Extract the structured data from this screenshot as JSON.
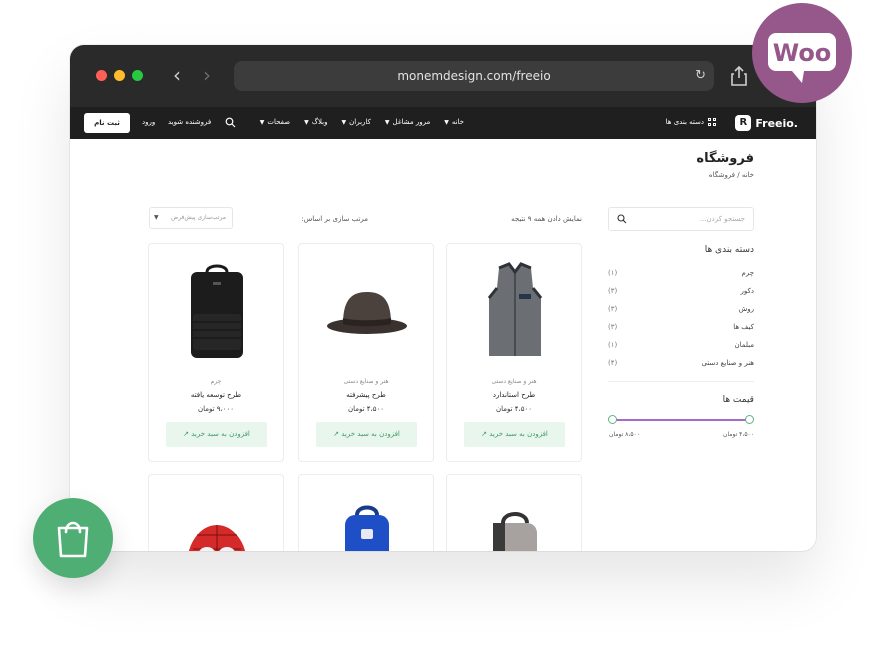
{
  "browser": {
    "url": "monemdesign.com/freeio"
  },
  "site_header": {
    "logo_text": "Freeio.",
    "logo_badge": "R",
    "categories_label": "دسته بندی ها",
    "menu": [
      {
        "label": "خانه"
      },
      {
        "label": "مرور مشاغل"
      },
      {
        "label": "کاربران"
      },
      {
        "label": "وبلاگ"
      },
      {
        "label": "صفحات"
      }
    ],
    "become_seller": "فروشنده شوید",
    "login": "ورود",
    "signup": "ثبت نام"
  },
  "page": {
    "title": "فروشگاه",
    "breadcrumb": "خانه / فروشگاه"
  },
  "sidebar": {
    "search_placeholder": "جستجو کردن...",
    "categories_title": "دسته بندی ها",
    "categories": [
      {
        "label": "چرم",
        "count": "(۱)"
      },
      {
        "label": "دکور",
        "count": "(۳)"
      },
      {
        "label": "روش",
        "count": "(۳)"
      },
      {
        "label": "کیف ها",
        "count": "(۳)"
      },
      {
        "label": "مبلمان",
        "count": "(۱)"
      },
      {
        "label": "هنر و صنایع دستی",
        "count": "(۴)"
      }
    ],
    "price_title": "قیمت ها",
    "price_min": "۴،۵۰۰ تومان",
    "price_max": "۸،۵۰۰ تومان"
  },
  "shop_toolbar": {
    "result_count": "نمایش دادن همه ۹ نتیجه",
    "sort_label": "مرتب سازی بر اساس:",
    "sort_value": "مرتب‌سازی پیش‌فرض"
  },
  "products": [
    {
      "category": "هنر و صنایع دستی",
      "name": "طرح استاندارد",
      "price": "۴،۵۰۰ تومان",
      "button": "افزودن به سبد خرید"
    },
    {
      "category": "هنر و صنایع دستی",
      "name": "طرح پیشرفته",
      "price": "۴،۵۰۰ تومان",
      "button": "افزودن به سبد خرید"
    },
    {
      "category": "چرم",
      "name": "طرح توسعه یافته",
      "price": "۹،۰۰۰ تومان",
      "button": "افزودن به سبد خرید"
    }
  ],
  "badges": {
    "woo_text": "Woo"
  },
  "colors": {
    "accent_green": "#4fae74",
    "woo_purple": "#96588a",
    "header_dark": "#1f1f1f",
    "slider_purple": "#a46bc9"
  }
}
